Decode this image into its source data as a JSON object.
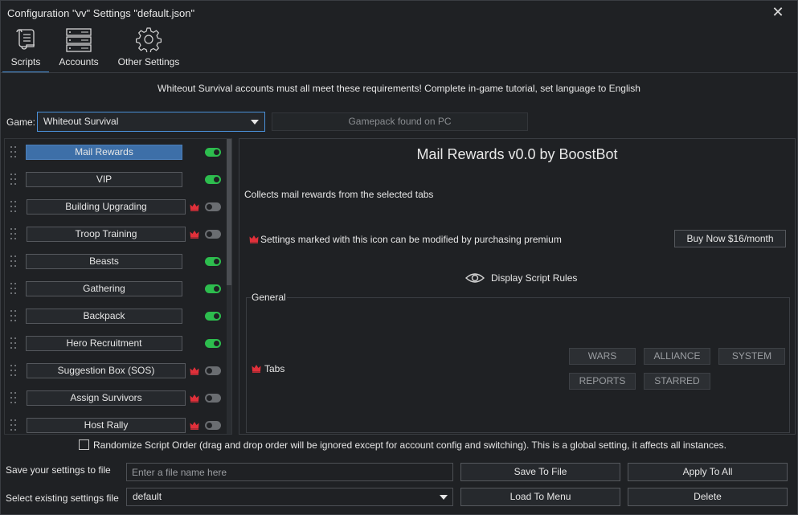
{
  "window": {
    "title": "Configuration \"vv\" Settings \"default.json\"",
    "close_glyph": "✕"
  },
  "toolbar": {
    "scripts_label": "Scripts",
    "accounts_label": "Accounts",
    "other_settings_label": "Other Settings",
    "active_tab": "Scripts",
    "accent_color": "#4a90d9"
  },
  "notice": "Whiteout Survival accounts must all meet these requirements! Complete in-game tutorial, set language to English",
  "game": {
    "label": "Game:",
    "selected": "Whiteout Survival",
    "gamepack_status": "Gamepack found on PC"
  },
  "scripts": [
    {
      "name": "Mail Rewards",
      "enabled": true,
      "premium": false,
      "selected": true
    },
    {
      "name": "VIP",
      "enabled": true,
      "premium": false,
      "selected": false
    },
    {
      "name": "Building Upgrading",
      "enabled": false,
      "premium": true,
      "selected": false
    },
    {
      "name": "Troop Training",
      "enabled": false,
      "premium": true,
      "selected": false
    },
    {
      "name": "Beasts",
      "enabled": true,
      "premium": false,
      "selected": false
    },
    {
      "name": "Gathering",
      "enabled": true,
      "premium": false,
      "selected": false
    },
    {
      "name": "Backpack",
      "enabled": true,
      "premium": false,
      "selected": false
    },
    {
      "name": "Hero Recruitment",
      "enabled": true,
      "premium": false,
      "selected": false
    },
    {
      "name": "Suggestion Box (SOS)",
      "enabled": false,
      "premium": true,
      "selected": false
    },
    {
      "name": "Assign Survivors",
      "enabled": false,
      "premium": true,
      "selected": false
    },
    {
      "name": "Host Rally",
      "enabled": false,
      "premium": true,
      "selected": false
    }
  ],
  "panel": {
    "title": "Mail Rewards v0.0 by BoostBot",
    "description": "Collects mail rewards from the selected tabs",
    "premium_note": "Settings marked with this icon can be modified by purchasing premium",
    "buy_label": "Buy Now $16/month",
    "rules_label": "Display Script Rules",
    "group_label": "General",
    "tabs_label": "Tabs",
    "tabs": [
      "WARS",
      "ALLIANCE",
      "SYSTEM",
      "REPORTS",
      "STARRED"
    ]
  },
  "randomize_label": "Randomize Script Order (drag and drop order will be ignored except for account config and switching). This is a global setting, it affects all instances.",
  "bottom": {
    "save_label": "Save your settings to file",
    "filename_placeholder": "Enter a file name here",
    "save_to_file": "Save To File",
    "apply_to_all": "Apply To All",
    "select_label": "Select existing settings file",
    "selected_file": "default",
    "load_to_menu": "Load To Menu",
    "delete": "Delete"
  },
  "colors": {
    "toggle_on": "#2dbd4e",
    "toggle_off": "#6a6d71",
    "crown": "#e0303a",
    "selected_script": "#3d6fa8"
  }
}
